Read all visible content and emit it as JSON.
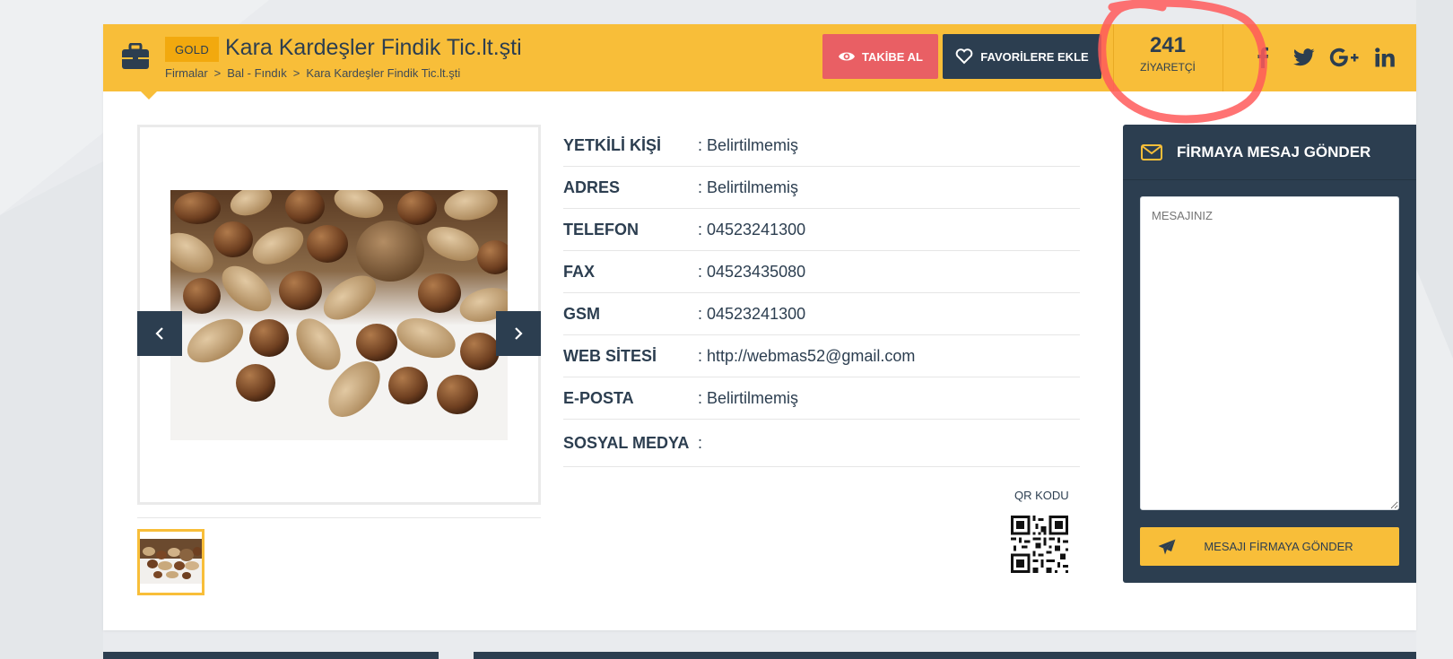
{
  "header": {
    "badge": "GOLD",
    "company_name": "Kara Kardeşler Findik Tic.lt.şti",
    "breadcrumb": [
      "Firmalar",
      "Bal - Fındık",
      "Kara Kardeşler Findik Tic.lt.şti"
    ],
    "breadcrumb_separator": ">",
    "follow_label": "TAKİBE AL",
    "favorite_label": "FAVORİLERE EKLE",
    "visitor_count": "241",
    "visitor_label": "ZİYARETÇİ",
    "social_icons": [
      "facebook-icon",
      "twitter-icon",
      "google-plus-icon",
      "linkedin-icon"
    ]
  },
  "details": [
    {
      "label": "YETKİLİ KİŞİ",
      "value": ": Belirtilmemiş"
    },
    {
      "label": "ADRES",
      "value": ": Belirtilmemiş"
    },
    {
      "label": "TELEFON",
      "value": ": 04523241300"
    },
    {
      "label": "FAX",
      "value": ": 04523435080"
    },
    {
      "label": "GSM",
      "value": ": 04523241300"
    },
    {
      "label": "WEB SİTESİ",
      "value": ": http://webmas52@gmail.com"
    },
    {
      "label": "E-POSTA",
      "value": ": Belirtilmemiş"
    },
    {
      "label": "SOSYAL MEDYA",
      "value": ":"
    }
  ],
  "qr": {
    "label": "QR KODU"
  },
  "message_panel": {
    "title": "FİRMAYA MESAJ GÖNDER",
    "placeholder": "MESAJINIZ",
    "send_label": "MESAJI FİRMAYA GÖNDER"
  },
  "colors": {
    "accent": "#f8be39",
    "dark": "#2c3e50",
    "follow": "#e95f64",
    "annotation": "#ff5a5a"
  }
}
